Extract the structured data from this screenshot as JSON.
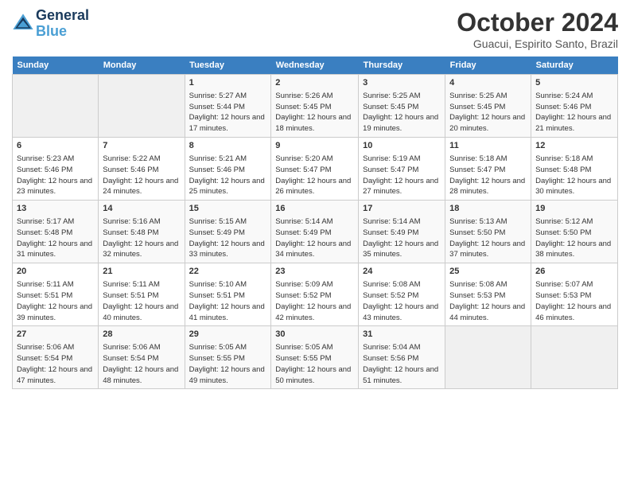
{
  "header": {
    "logo_line1": "General",
    "logo_line2": "Blue",
    "month": "October 2024",
    "location": "Guacui, Espirito Santo, Brazil"
  },
  "weekdays": [
    "Sunday",
    "Monday",
    "Tuesday",
    "Wednesday",
    "Thursday",
    "Friday",
    "Saturday"
  ],
  "weeks": [
    [
      {
        "day": "",
        "empty": true
      },
      {
        "day": "",
        "empty": true
      },
      {
        "day": "1",
        "sunrise": "5:27 AM",
        "sunset": "5:44 PM",
        "daylight": "12 hours and 17 minutes."
      },
      {
        "day": "2",
        "sunrise": "5:26 AM",
        "sunset": "5:45 PM",
        "daylight": "12 hours and 18 minutes."
      },
      {
        "day": "3",
        "sunrise": "5:25 AM",
        "sunset": "5:45 PM",
        "daylight": "12 hours and 19 minutes."
      },
      {
        "day": "4",
        "sunrise": "5:25 AM",
        "sunset": "5:45 PM",
        "daylight": "12 hours and 20 minutes."
      },
      {
        "day": "5",
        "sunrise": "5:24 AM",
        "sunset": "5:46 PM",
        "daylight": "12 hours and 21 minutes."
      }
    ],
    [
      {
        "day": "6",
        "sunrise": "5:23 AM",
        "sunset": "5:46 PM",
        "daylight": "12 hours and 23 minutes."
      },
      {
        "day": "7",
        "sunrise": "5:22 AM",
        "sunset": "5:46 PM",
        "daylight": "12 hours and 24 minutes."
      },
      {
        "day": "8",
        "sunrise": "5:21 AM",
        "sunset": "5:46 PM",
        "daylight": "12 hours and 25 minutes."
      },
      {
        "day": "9",
        "sunrise": "5:20 AM",
        "sunset": "5:47 PM",
        "daylight": "12 hours and 26 minutes."
      },
      {
        "day": "10",
        "sunrise": "5:19 AM",
        "sunset": "5:47 PM",
        "daylight": "12 hours and 27 minutes."
      },
      {
        "day": "11",
        "sunrise": "5:18 AM",
        "sunset": "5:47 PM",
        "daylight": "12 hours and 28 minutes."
      },
      {
        "day": "12",
        "sunrise": "5:18 AM",
        "sunset": "5:48 PM",
        "daylight": "12 hours and 30 minutes."
      }
    ],
    [
      {
        "day": "13",
        "sunrise": "5:17 AM",
        "sunset": "5:48 PM",
        "daylight": "12 hours and 31 minutes."
      },
      {
        "day": "14",
        "sunrise": "5:16 AM",
        "sunset": "5:48 PM",
        "daylight": "12 hours and 32 minutes."
      },
      {
        "day": "15",
        "sunrise": "5:15 AM",
        "sunset": "5:49 PM",
        "daylight": "12 hours and 33 minutes."
      },
      {
        "day": "16",
        "sunrise": "5:14 AM",
        "sunset": "5:49 PM",
        "daylight": "12 hours and 34 minutes."
      },
      {
        "day": "17",
        "sunrise": "5:14 AM",
        "sunset": "5:49 PM",
        "daylight": "12 hours and 35 minutes."
      },
      {
        "day": "18",
        "sunrise": "5:13 AM",
        "sunset": "5:50 PM",
        "daylight": "12 hours and 37 minutes."
      },
      {
        "day": "19",
        "sunrise": "5:12 AM",
        "sunset": "5:50 PM",
        "daylight": "12 hours and 38 minutes."
      }
    ],
    [
      {
        "day": "20",
        "sunrise": "5:11 AM",
        "sunset": "5:51 PM",
        "daylight": "12 hours and 39 minutes."
      },
      {
        "day": "21",
        "sunrise": "5:11 AM",
        "sunset": "5:51 PM",
        "daylight": "12 hours and 40 minutes."
      },
      {
        "day": "22",
        "sunrise": "5:10 AM",
        "sunset": "5:51 PM",
        "daylight": "12 hours and 41 minutes."
      },
      {
        "day": "23",
        "sunrise": "5:09 AM",
        "sunset": "5:52 PM",
        "daylight": "12 hours and 42 minutes."
      },
      {
        "day": "24",
        "sunrise": "5:08 AM",
        "sunset": "5:52 PM",
        "daylight": "12 hours and 43 minutes."
      },
      {
        "day": "25",
        "sunrise": "5:08 AM",
        "sunset": "5:53 PM",
        "daylight": "12 hours and 44 minutes."
      },
      {
        "day": "26",
        "sunrise": "5:07 AM",
        "sunset": "5:53 PM",
        "daylight": "12 hours and 46 minutes."
      }
    ],
    [
      {
        "day": "27",
        "sunrise": "5:06 AM",
        "sunset": "5:54 PM",
        "daylight": "12 hours and 47 minutes."
      },
      {
        "day": "28",
        "sunrise": "5:06 AM",
        "sunset": "5:54 PM",
        "daylight": "12 hours and 48 minutes."
      },
      {
        "day": "29",
        "sunrise": "5:05 AM",
        "sunset": "5:55 PM",
        "daylight": "12 hours and 49 minutes."
      },
      {
        "day": "30",
        "sunrise": "5:05 AM",
        "sunset": "5:55 PM",
        "daylight": "12 hours and 50 minutes."
      },
      {
        "day": "31",
        "sunrise": "5:04 AM",
        "sunset": "5:56 PM",
        "daylight": "12 hours and 51 minutes."
      },
      {
        "day": "",
        "empty": true
      },
      {
        "day": "",
        "empty": true
      }
    ]
  ]
}
